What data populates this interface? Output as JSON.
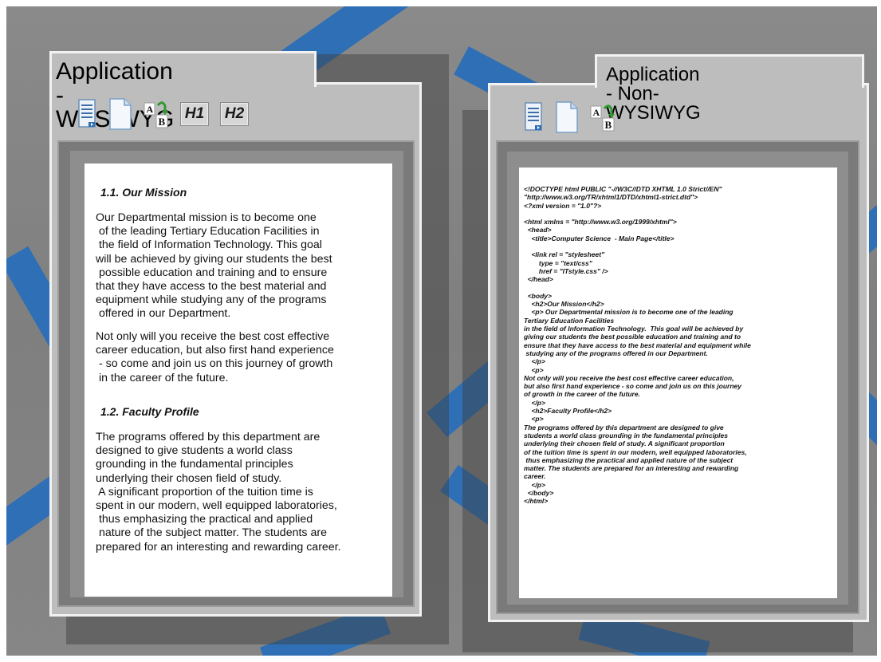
{
  "colors": {
    "accent_stripe": "#2f6fb5",
    "frame": "#bdbdbd",
    "frame_border": "#f2f2f2"
  },
  "wysiwyg": {
    "title": "Application - WYSIWYG",
    "toolbar": {
      "doc_list_icon": "document-list-icon",
      "new_doc_icon": "blank-document-icon",
      "replace_icon": "ab-replace-icon",
      "h1_label": "H1",
      "h2_label": "H2"
    },
    "doc": {
      "heading1": "1.1. Our Mission",
      "para1": "Our Departmental mission is to become one\n of the leading Tertiary Education Facilities in\n the field of Information Technology. This goal\nwill be achieved by giving our students the best\n possible education and training and to ensure\nthat they have access to the best material and\nequipment while studying any of the programs\n offered in our Department.",
      "para2": "Not only will you receive the best cost effective\ncareer education, but also first hand experience\n - so come and join us on this journey of growth\n in the career of the future.",
      "heading2": "1.2. Faculty Profile",
      "para3": "The programs offered by this department are\ndesigned to give students a world class\ngrounding in the fundamental principles\nunderlying their chosen field of study.\n A significant proportion of the tuition time is\nspent in our modern, well equipped laboratories,\n thus emphasizing the practical and applied\n nature of the subject matter. The students are\nprepared for an interesting and rewarding career."
    }
  },
  "non_wysiwyg": {
    "title": "Application - Non-WYSIWYG",
    "toolbar": {
      "doc_list_icon": "document-list-icon",
      "new_doc_icon": "blank-document-icon",
      "replace_icon": "ab-replace-icon"
    },
    "source": "<!DOCTYPE html PUBLIC \"-//W3C//DTD XHTML 1.0 Strict//EN\"\n\"http://www.w3.org/TR/xhtml1/DTD/xhtml1-strict.dtd\">\n<?xml version = \"1.0\"?>\n\n<html xmlns = \"http://www.w3.org/1999/xhtml\">\n  <head>\n    <title>Computer Science  - Main Page</title>\n\n    <link rel = \"stylesheet\"\n        type = \"text/css\"\n        href = \"ITstyle.css\" />\n  </head>\n\n  <body>\n    <h2>Our Mission</h2>\n    <p> Our Departmental mission is to become one of the leading\nTertiary Education Facilities\nin the field of Information Technology.  This goal will be achieved by\ngiving our students the best possible education and training and to\nensure that they have access to the best material and equipment while\n studying any of the programs offered in our Department.\n    </p>\n    <p>\nNot only will you receive the best cost effective career education,\nbut also first hand experience - so come and join us on this journey\nof growth in the career of the future.\n    </p>\n    <h2>Faculty Profile</h2>\n    <p>\nThe programs offered by this department are designed to give\nstudents a world class grounding in the fundamental principles\nunderlying their chosen field of study. A significant proportion\nof the tuition time is spent in our modern, well equipped laboratories,\n thus emphasizing the practical and applied nature of the subject\nmatter. The students are prepared for an interesting and rewarding\ncareer.\n    </p>\n  </body>\n</html>"
  }
}
